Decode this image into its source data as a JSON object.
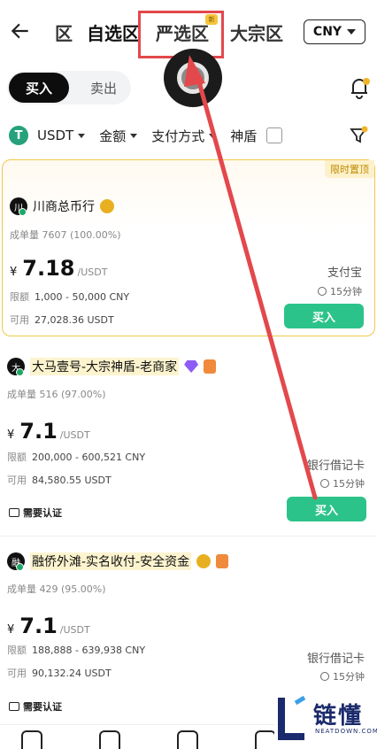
{
  "header": {
    "tabs": [
      "区",
      "自选区",
      "严选区",
      "大宗区"
    ],
    "new_badge": "新",
    "currency": "CNY"
  },
  "trade_toggle": {
    "buy": "买入",
    "sell": "卖出"
  },
  "filters": {
    "asset": "USDT",
    "asset_icon": "T",
    "amount": "金额",
    "payment": "支付方式",
    "shield": "神盾"
  },
  "listings": [
    {
      "badge": "限时置顶",
      "avatar": "川",
      "name": "川商总币行",
      "stats": "成单量 7607 (100.00%)",
      "currency_symbol": "¥",
      "price": "7.18",
      "unit": "/USDT",
      "limit_label": "限额",
      "limit": "1,000 - 50,000 CNY",
      "available_label": "可用",
      "available": "27,028.36 USDT",
      "payment": "支付宝",
      "time": "15分钟",
      "button": "买入"
    },
    {
      "avatar": "大",
      "name": "大马壹号-大宗神盾-老商家",
      "stats": "成单量 516 (97.00%)",
      "currency_symbol": "¥",
      "price": "7.1",
      "unit": "/USDT",
      "limit_label": "限额",
      "limit": "200,000 - 600,521 CNY",
      "available_label": "可用",
      "available": "84,580.55 USDT",
      "payment": "银行借记卡",
      "time": "15分钟",
      "button": "买入",
      "cert": "需要认证"
    },
    {
      "avatar": "融",
      "name": "融侨外滩-实名收付-安全资金",
      "stats": "成单量 429 (95.00%)",
      "currency_symbol": "¥",
      "price": "7.1",
      "unit": "/USDT",
      "limit_label": "限额",
      "limit": "188,888 - 639,938 CNY",
      "available_label": "可用",
      "available": "90,132.24 USDT",
      "payment": "银行借记卡",
      "time": "15分钟",
      "cert": "需要认证"
    }
  ],
  "watermark": {
    "cn": "链懂",
    "en": "NEATDOWN.COM"
  },
  "colors": {
    "accent_green": "#2cc38a",
    "highlight_red": "#e3484c",
    "promo_border": "#f0c84a"
  }
}
